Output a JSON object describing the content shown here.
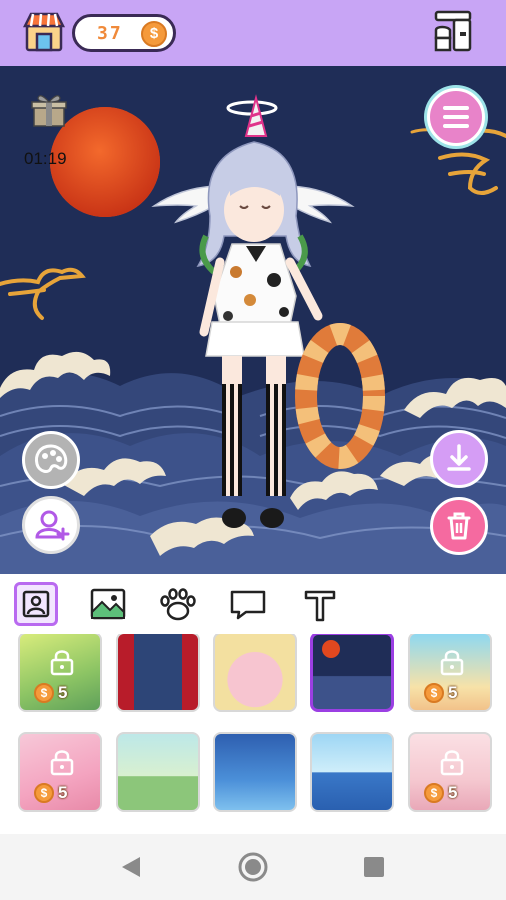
{
  "header": {
    "coins": "37",
    "coin_symbol": "$",
    "shop_icon": "shop-icon",
    "wardrobe_icon": "wardrobe-icon"
  },
  "scene": {
    "timer": "01:19",
    "gift_icon": "gift-icon",
    "buttons": [
      "menu-icon",
      "palette-icon",
      "add-character-icon",
      "download-icon",
      "trash-icon"
    ]
  },
  "tabs": [
    {
      "icon": "portrait-icon",
      "active": true
    },
    {
      "icon": "image-icon",
      "active": false
    },
    {
      "icon": "paw-icon",
      "active": false
    },
    {
      "icon": "speech-bubble-icon",
      "active": false
    },
    {
      "icon": "text-icon",
      "active": false
    }
  ],
  "backgrounds": [
    {
      "locked": true,
      "price": "5"
    },
    {
      "locked": false,
      "price": ""
    },
    {
      "locked": false,
      "price": ""
    },
    {
      "locked": false,
      "price": "",
      "selected": true
    },
    {
      "locked": true,
      "price": "5"
    },
    {
      "locked": true,
      "price": "5"
    },
    {
      "locked": false,
      "price": ""
    },
    {
      "locked": false,
      "price": ""
    },
    {
      "locked": false,
      "price": ""
    },
    {
      "locked": true,
      "price": "5"
    }
  ],
  "colors": {
    "header_bg": "#c8a5f5",
    "scene_bg": "#1f2d57",
    "accent_purple": "#9b3fe3",
    "coin_orange": "#f59a3b"
  }
}
